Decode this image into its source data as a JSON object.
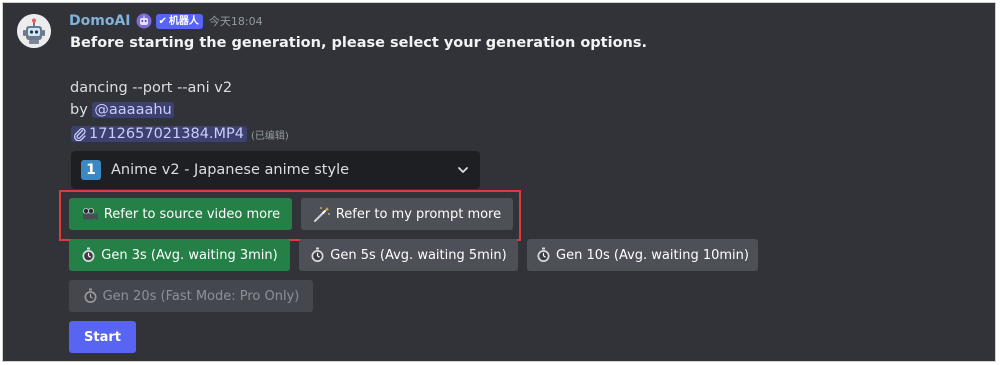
{
  "message": {
    "author": "DomoAI",
    "bot_tag": "机器人",
    "timestamp": "今天18:04",
    "headline": "Before starting the generation, please select your generation options.",
    "command": "dancing --port --ani v2",
    "by_prefix": "by",
    "mention": "@aaaaahu",
    "attachment": "1712657021384.MP4",
    "edited_label": "(已编辑)"
  },
  "style_select": {
    "number": "1",
    "selected": "Anime v2 - Japanese anime style"
  },
  "refer_buttons": [
    {
      "label": "Refer to source video more",
      "icon": "movie-camera-icon",
      "style": "green"
    },
    {
      "label": "Refer to my prompt more",
      "icon": "magic-wand-icon",
      "style": "grey"
    }
  ],
  "gen_buttons": [
    {
      "label": "Gen 3s (Avg. waiting 3min)",
      "icon": "stopwatch-icon",
      "style": "green"
    },
    {
      "label": "Gen 5s (Avg. waiting 5min)",
      "icon": "stopwatch-icon",
      "style": "grey"
    },
    {
      "label": "Gen 10s (Avg. waiting 10min)",
      "icon": "stopwatch-icon",
      "style": "grey"
    },
    {
      "label": "Gen 20s (Fast Mode: Pro Only)",
      "icon": "stopwatch-icon",
      "style": "disabled"
    }
  ],
  "start_button": {
    "label": "Start"
  },
  "colors": {
    "background": "#313338",
    "green": "#248046",
    "grey": "#4e5058",
    "blurple": "#5865f2",
    "highlight_border": "#e03a3a"
  }
}
